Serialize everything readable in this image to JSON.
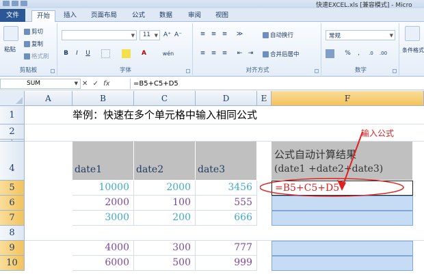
{
  "window": {
    "title": "快速EXCEL.xls  [兼容模式] - Micro"
  },
  "tabs": [
    {
      "label": "文件"
    },
    {
      "label": "开始"
    },
    {
      "label": "插入"
    },
    {
      "label": "页面布局"
    },
    {
      "label": "公式"
    },
    {
      "label": "数据"
    },
    {
      "label": "审阅"
    },
    {
      "label": "视图"
    }
  ],
  "ribbon": {
    "clipboard": {
      "paste": "粘贴",
      "cut": "剪切",
      "copy": "复制",
      "format_painter": "格式刷",
      "label": "剪贴板"
    },
    "font": {
      "size": "11",
      "grow": "A⁺",
      "shrink": "A⁻",
      "bold": "B",
      "italic": "I",
      "underline": "U",
      "font_color": "A",
      "wen": "wén",
      "label": "字体"
    },
    "alignment": {
      "wrap": "自动换行",
      "merge": "合并后居中",
      "label": "对齐方式"
    },
    "number": {
      "format": "常规",
      "percent": "%",
      "comma": ",",
      "label": "数字"
    },
    "styles": {
      "cond_format": "条件格式"
    }
  },
  "formula_bar": {
    "name_box": "SUM",
    "cancel": "✕",
    "enter": "✓",
    "fx": "fx",
    "formula": "=B5+C5+D5"
  },
  "columns": [
    "A",
    "B",
    "C",
    "D",
    "E",
    "F"
  ],
  "rows": [
    "1",
    "2",
    "3",
    "4",
    "5",
    "6",
    "7",
    "8",
    "9",
    "10"
  ],
  "sheet": {
    "title": "举例：快速在多个单元格中输入相同公式",
    "headers": [
      "date1",
      "date2",
      "date3"
    ],
    "result_header": "公式自动计算结果",
    "result_sub": "(date1 +date2+date3)",
    "data": [
      [
        "10000",
        "2000",
        "3456"
      ],
      [
        "2000",
        "100",
        "555"
      ],
      [
        "3000",
        "200",
        "666"
      ],
      [
        "4000",
        "300",
        "777"
      ],
      [
        "6000",
        "500",
        "999"
      ]
    ],
    "active_formula": "=B5+C5+D5",
    "annotation": "输入公式"
  },
  "colors": {
    "annotation_red": "#e02020",
    "accent_blue": "#c6dcf5",
    "header_gray": "#c0c0c0"
  }
}
